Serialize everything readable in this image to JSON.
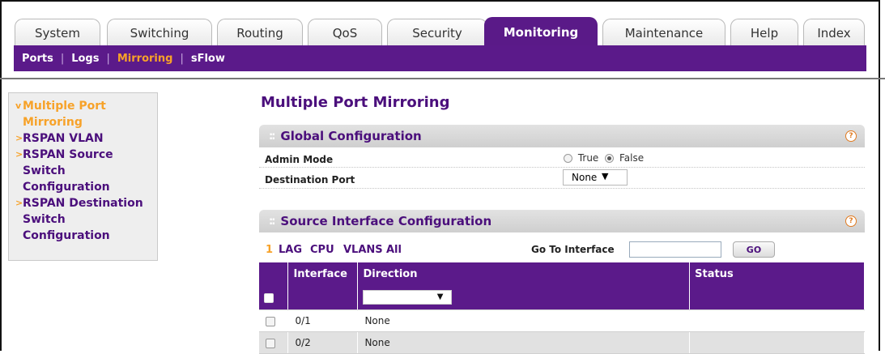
{
  "tabs": [
    {
      "label": "System",
      "active": false
    },
    {
      "label": "Switching",
      "active": false
    },
    {
      "label": "Routing",
      "active": false
    },
    {
      "label": "QoS",
      "active": false
    },
    {
      "label": "Security",
      "active": false
    },
    {
      "label": "Monitoring",
      "active": true
    },
    {
      "label": "Maintenance",
      "active": false
    },
    {
      "label": "Help",
      "active": false
    },
    {
      "label": "Index",
      "active": false
    }
  ],
  "subnav": [
    {
      "label": "Ports",
      "active": false
    },
    {
      "label": "Logs",
      "active": false
    },
    {
      "label": "Mirroring",
      "active": true
    },
    {
      "label": "sFlow",
      "active": false
    }
  ],
  "sidebar": {
    "items": [
      {
        "lines": [
          "Multiple Port",
          "Mirroring"
        ],
        "active": true,
        "arrow": "v"
      },
      {
        "lines": [
          "RSPAN VLAN"
        ],
        "active": false,
        "arrow": ">"
      },
      {
        "lines": [
          "RSPAN Source",
          "Switch",
          "Configuration"
        ],
        "active": false,
        "arrow": ">"
      },
      {
        "lines": [
          "RSPAN Destination",
          "Switch",
          "Configuration"
        ],
        "active": false,
        "arrow": ">"
      }
    ]
  },
  "page_title": "Multiple Port Mirroring",
  "global": {
    "title": "Global Configuration",
    "admin_mode_label": "Admin Mode",
    "admin_mode_options": [
      "True",
      "False"
    ],
    "admin_mode_selected": "False",
    "destination_port_label": "Destination Port",
    "destination_port_value": "None"
  },
  "source": {
    "title": "Source Interface Configuration",
    "filters": [
      "1",
      "LAG",
      "CPU",
      "VLANS",
      "All"
    ],
    "active_filter": "1",
    "goto_label": "Go To Interface",
    "goto_value": "",
    "go_button": "GO",
    "columns": [
      "Interface",
      "Direction",
      "Status"
    ],
    "rows": [
      {
        "interface": "0/1",
        "direction": "None",
        "status": ""
      },
      {
        "interface": "0/2",
        "direction": "None",
        "status": ""
      }
    ]
  },
  "colors": {
    "purple": "#5b1a8a",
    "orange": "#f7a229",
    "title_purple": "#4b0f7c"
  },
  "icons": {
    "help": "help-icon",
    "dropdown": "caret-down-icon"
  }
}
